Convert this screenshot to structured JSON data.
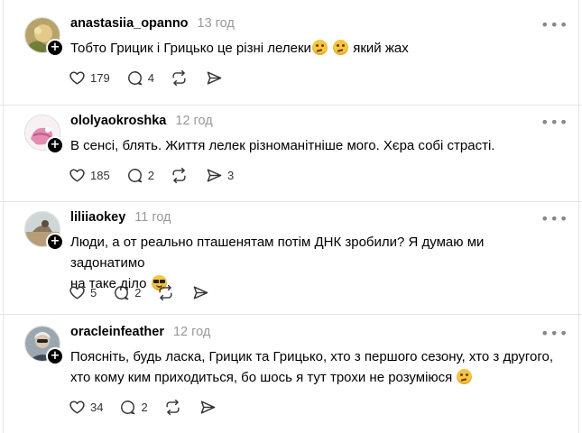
{
  "posts": [
    {
      "username": "anastasiia_opanno",
      "time": "13 год",
      "text_lines": [
        "Тобто Грицик і Грицько це різні лелеки",
        "",
        "",
        " який жах"
      ],
      "likes": "179",
      "replies": "4",
      "reposts": "",
      "shares": ""
    },
    {
      "username": "ololyaokroshka",
      "time": "12 год",
      "text_lines": [
        "В сенсі, блять. Життя лелек різноманітніше мого. Хєра собі страсті."
      ],
      "likes": "185",
      "replies": "2",
      "reposts": "",
      "shares": "3"
    },
    {
      "username": "liliiaokey",
      "time": "11 год",
      "text_lines": [
        "Люди, а от реально пташенятам потім ДНК зробили? Я думаю ми задонатимо",
        "на таке діло "
      ],
      "likes": "5",
      "replies": "2",
      "reposts": "",
      "shares": ""
    },
    {
      "username": "oracleinfeather",
      "time": "12 год",
      "text_lines": [
        "Поясніть, будь ласка, Грицик та Грицько, хто з першого сезону, хто з другого,",
        "хто кому ким приходиться, бо шось я тут трохи не розуміюся "
      ],
      "likes": "34",
      "replies": "2",
      "reposts": "",
      "shares": ""
    }
  ],
  "icons": {
    "like": "heart-icon",
    "reply": "comment-icon",
    "repost": "repost-icon",
    "share": "share-icon",
    "more": "more-options-icon",
    "follow": "plus-follow-icon",
    "emoji_thinking": "thinking-face-emoji",
    "emoji_cool": "sunglasses-face-emoji"
  },
  "colors": {
    "text": "#000000",
    "muted": "#999999",
    "divider": "#e5e5e5",
    "icon": "#333333"
  }
}
